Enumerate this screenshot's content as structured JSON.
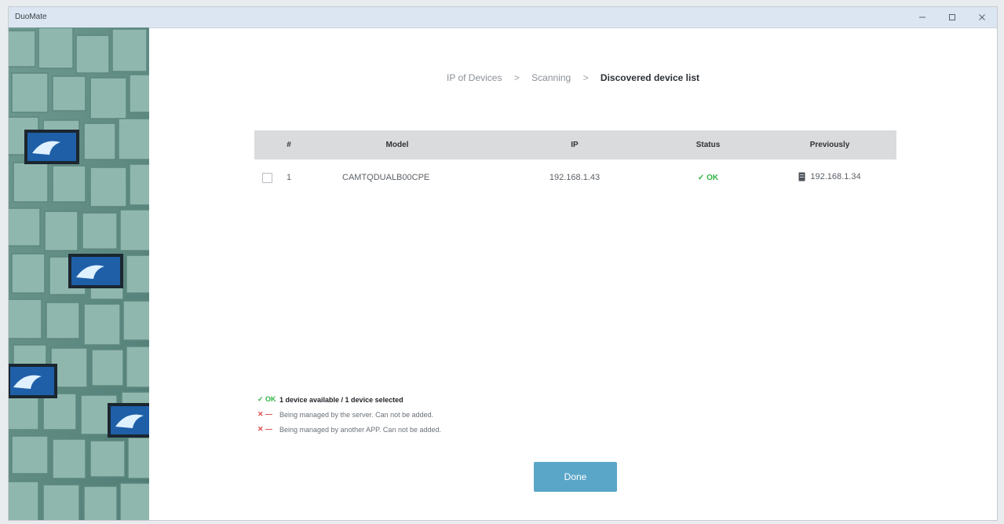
{
  "window": {
    "title": "DuoMate",
    "controls": {
      "minimize": "–",
      "maximize": "▢",
      "close": "✕"
    }
  },
  "breadcrumb": [
    {
      "label": "IP of Devices"
    },
    {
      "label": "Scanning"
    },
    {
      "label": "Discovered device list"
    }
  ],
  "table": {
    "headers": {
      "num": "#",
      "model": "Model",
      "ip": "IP",
      "status": "Status",
      "previously": "Previously"
    },
    "rows": [
      {
        "num": "1",
        "model": "CAMTQDUALB00CPE",
        "ip": "192.168.1.43",
        "status": "✓ OK",
        "previously": "192.168.1.34"
      }
    ]
  },
  "legend": [
    {
      "mark": "✓ OK",
      "text": "1 device available / 1 device selected"
    },
    {
      "mark": "✕ —",
      "text": "Being managed by the server. Can not be added."
    },
    {
      "mark": "✕ —",
      "text": "Being managed by another APP. Can not be added."
    }
  ],
  "actions": {
    "done": "Done"
  },
  "colors": {
    "accent": "#5aa6c8",
    "ok": "#2fb344",
    "error": "#e04848",
    "titlebar": "#dce6f2"
  }
}
